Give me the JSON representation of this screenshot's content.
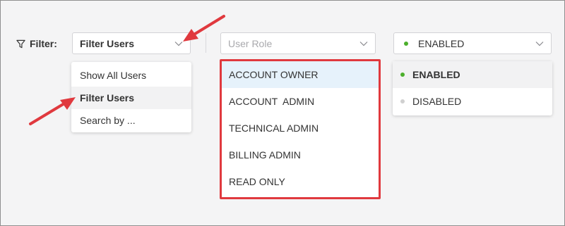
{
  "filter": {
    "label": "Filter:",
    "icon": "funnel-icon"
  },
  "mode_select": {
    "value": "Filter Users",
    "options": [
      "Show All Users",
      "Filter Users",
      "Search by ..."
    ],
    "selected_index": 1
  },
  "role_select": {
    "placeholder": "User Role",
    "options": [
      "ACCOUNT OWNER",
      "ACCOUNT  ADMIN",
      "TECHNICAL ADMIN",
      "BILLING ADMIN",
      "READ ONLY"
    ],
    "highlighted_index": 0
  },
  "status_select": {
    "value": "ENABLED",
    "options": [
      {
        "label": "ENABLED",
        "dot_color": "#4caf2c"
      },
      {
        "label": "DISABLED",
        "dot_color": "#d0d0d0"
      }
    ],
    "selected_index": 0
  },
  "colors": {
    "accent_green": "#4caf2c",
    "highlight_border": "#e0393e",
    "arrow": "#e0393e",
    "hover_blue": "#e6f2fb"
  }
}
